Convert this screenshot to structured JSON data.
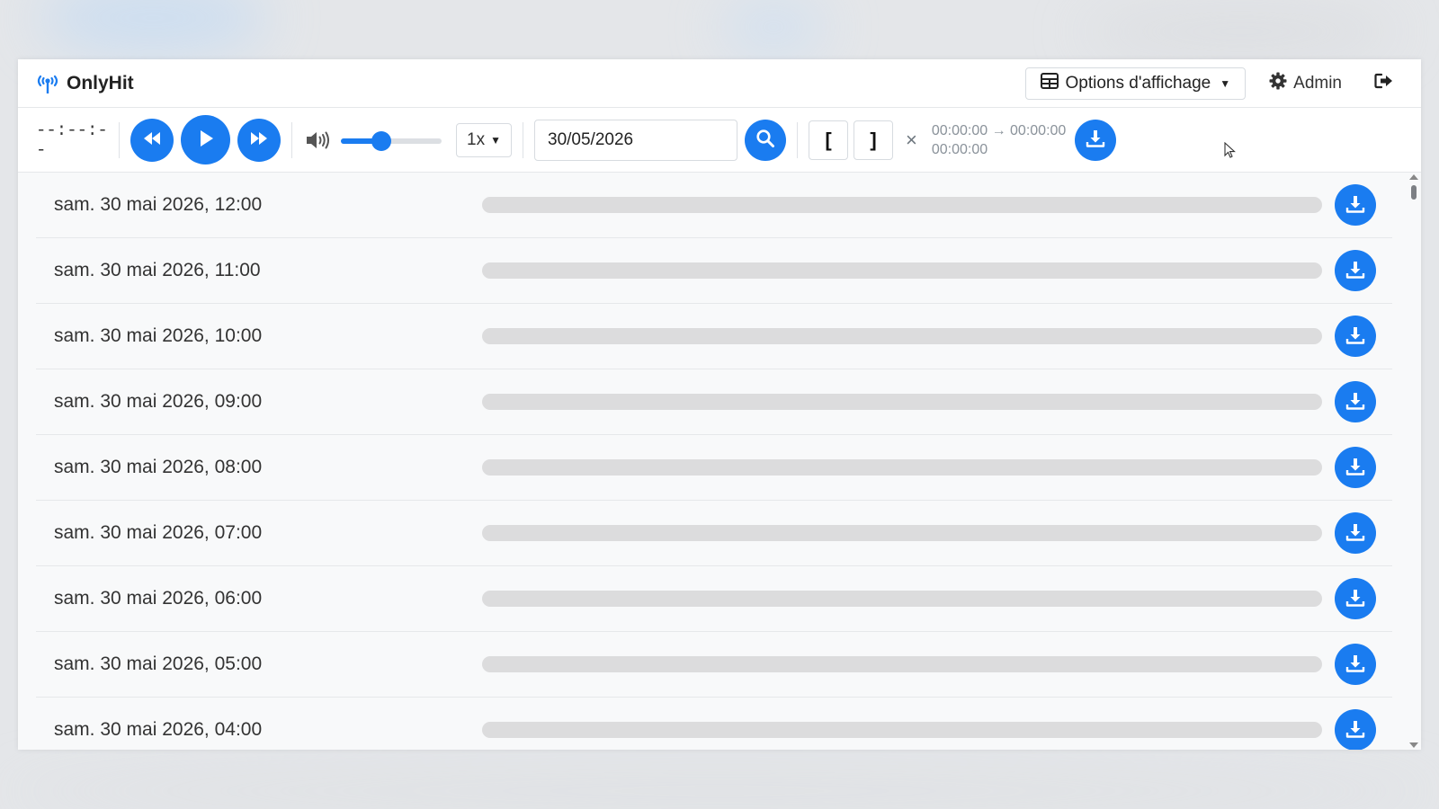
{
  "app": {
    "name": "OnlyHit",
    "accent_color": "#1a7cf0"
  },
  "header": {
    "options_label": "Options d'affichage",
    "options_icon": "table-icon",
    "admin_label": "Admin",
    "admin_icon": "gear-icon",
    "logout_icon": "sign-out-icon"
  },
  "player": {
    "time": "--:--:--",
    "volume_level": 0.4,
    "speed": "1x",
    "date_value": "30/05/2026",
    "bracket_start": "[",
    "bracket_end": "]",
    "clear_label": "×",
    "range_line1": "00:00:00 → 00:00:00",
    "range_line2": "00:00:00"
  },
  "hours": [
    {
      "label": "sam. 30 mai 2026, 12:00"
    },
    {
      "label": "sam. 30 mai 2026, 11:00"
    },
    {
      "label": "sam. 30 mai 2026, 10:00"
    },
    {
      "label": "sam. 30 mai 2026, 09:00"
    },
    {
      "label": "sam. 30 mai 2026, 08:00"
    },
    {
      "label": "sam. 30 mai 2026, 07:00"
    },
    {
      "label": "sam. 30 mai 2026, 06:00"
    },
    {
      "label": "sam. 30 mai 2026, 05:00"
    },
    {
      "label": "sam. 30 mai 2026, 04:00"
    }
  ]
}
